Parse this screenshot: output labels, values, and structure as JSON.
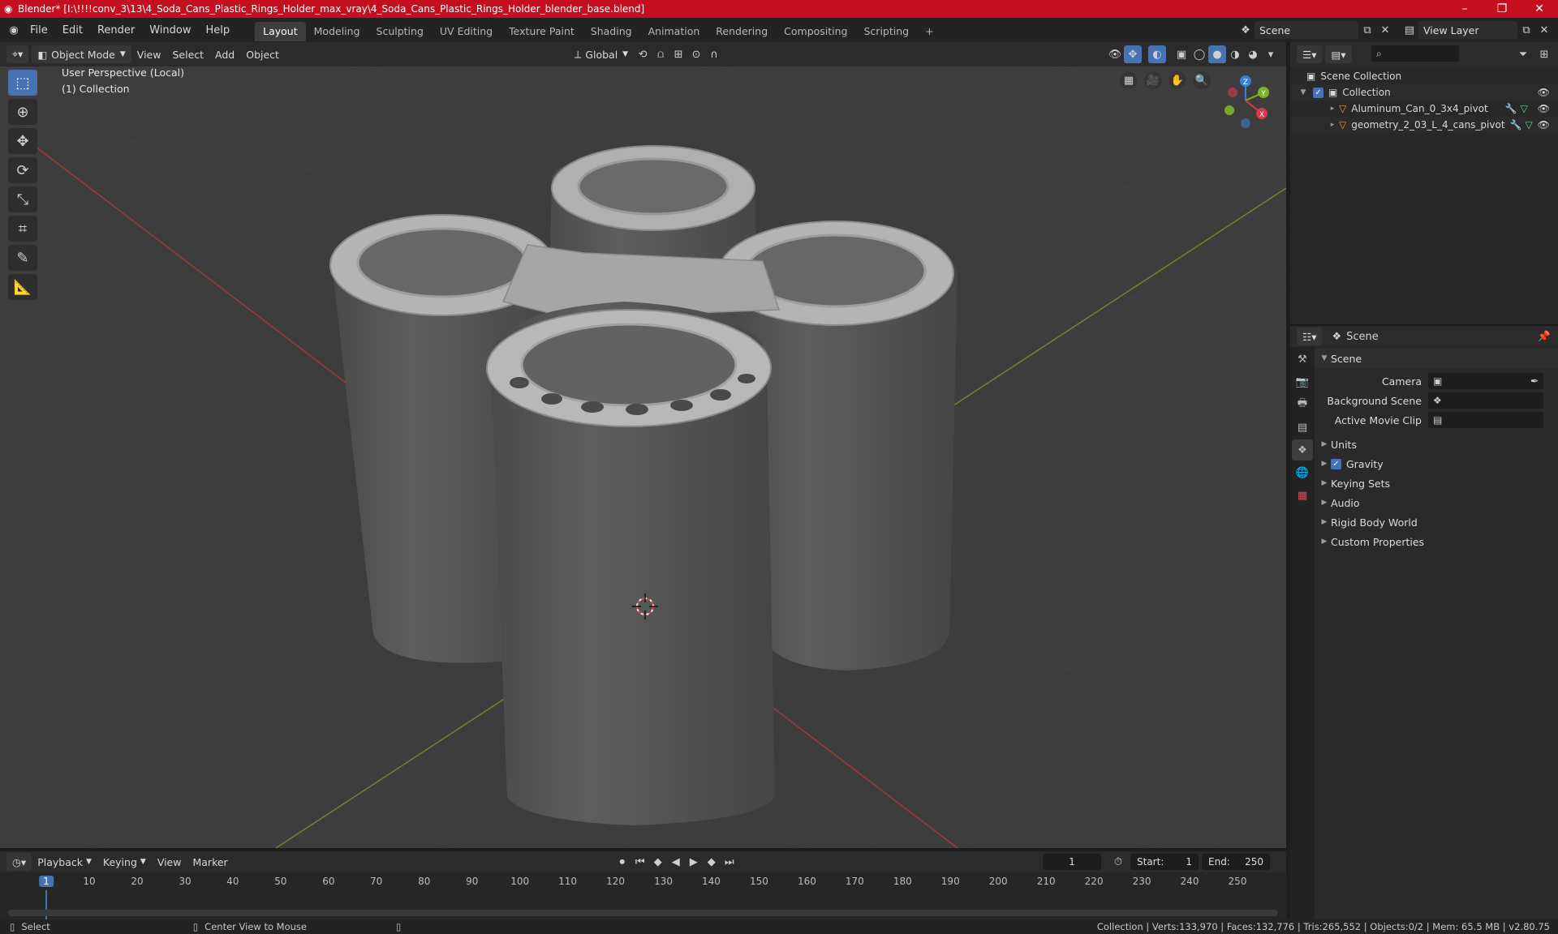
{
  "window": {
    "title": "Blender* [I:\\!!!!conv_3\\13\\4_Soda_Cans_Plastic_Rings_Holder_max_vray\\4_Soda_Cans_Plastic_Rings_Holder_blender_base.blend]",
    "min_icon": "–",
    "max_icon": "❐",
    "close_icon": "✕"
  },
  "menu": {
    "items": [
      "File",
      "Edit",
      "Render",
      "Window",
      "Help"
    ],
    "workspaces": [
      "Layout",
      "Modeling",
      "Sculpting",
      "UV Editing",
      "Texture Paint",
      "Shading",
      "Animation",
      "Rendering",
      "Compositing",
      "Scripting"
    ],
    "add_tab": "+",
    "scene_name": "Scene",
    "view_layer": "View Layer"
  },
  "viewport": {
    "mode": "Object Mode",
    "menus": [
      "View",
      "Select",
      "Add",
      "Object"
    ],
    "transform_orientation": "Global",
    "perspective_label": "User Perspective (Local)",
    "collection_label": "(1) Collection",
    "gizmo": {
      "x": "X",
      "y": "Y",
      "z": "Z"
    }
  },
  "outliner": {
    "search_placeholder": "",
    "rows": [
      {
        "label": "Scene Collection"
      },
      {
        "label": "Collection"
      },
      {
        "label": "Aluminum_Can_0_3x4_pivot"
      },
      {
        "label": "geometry_2_03_L_4_cans_pivot"
      }
    ]
  },
  "properties": {
    "header": "Scene",
    "panel_title": "Scene",
    "camera_label": "Camera",
    "background_scene_label": "Background Scene",
    "active_clip_label": "Active Movie Clip",
    "sections": [
      "Units",
      "Gravity",
      "Keying Sets",
      "Audio",
      "Rigid Body World",
      "Custom Properties"
    ]
  },
  "timeline": {
    "menus": [
      "Playback",
      "Keying",
      "View",
      "Marker"
    ],
    "current_frame": "1",
    "start_label": "Start:",
    "start": "1",
    "end_label": "End:",
    "end": "250",
    "ticks": [
      "1",
      "10",
      "20",
      "30",
      "40",
      "50",
      "60",
      "70",
      "80",
      "90",
      "100",
      "110",
      "120",
      "130",
      "140",
      "150",
      "160",
      "170",
      "180",
      "190",
      "200",
      "210",
      "220",
      "230",
      "240",
      "250"
    ]
  },
  "statusbar": {
    "select": "Select",
    "center_view": "Center View to Mouse",
    "stats": "Collection | Verts:133,970 | Faces:132,776 | Tris:265,552 | Objects:0/2 | Mem: 65.5 MB | v2.80.75"
  },
  "colors": {
    "accent": "#4772b3",
    "titlebar": "#c50e1f",
    "viewport_bg": "#3d3d3d",
    "axis_x": "#9b3a3a",
    "axis_y": "#6b8a2a",
    "can_body": "#5a5a5a",
    "ring_holder": "#b4b4b4"
  }
}
